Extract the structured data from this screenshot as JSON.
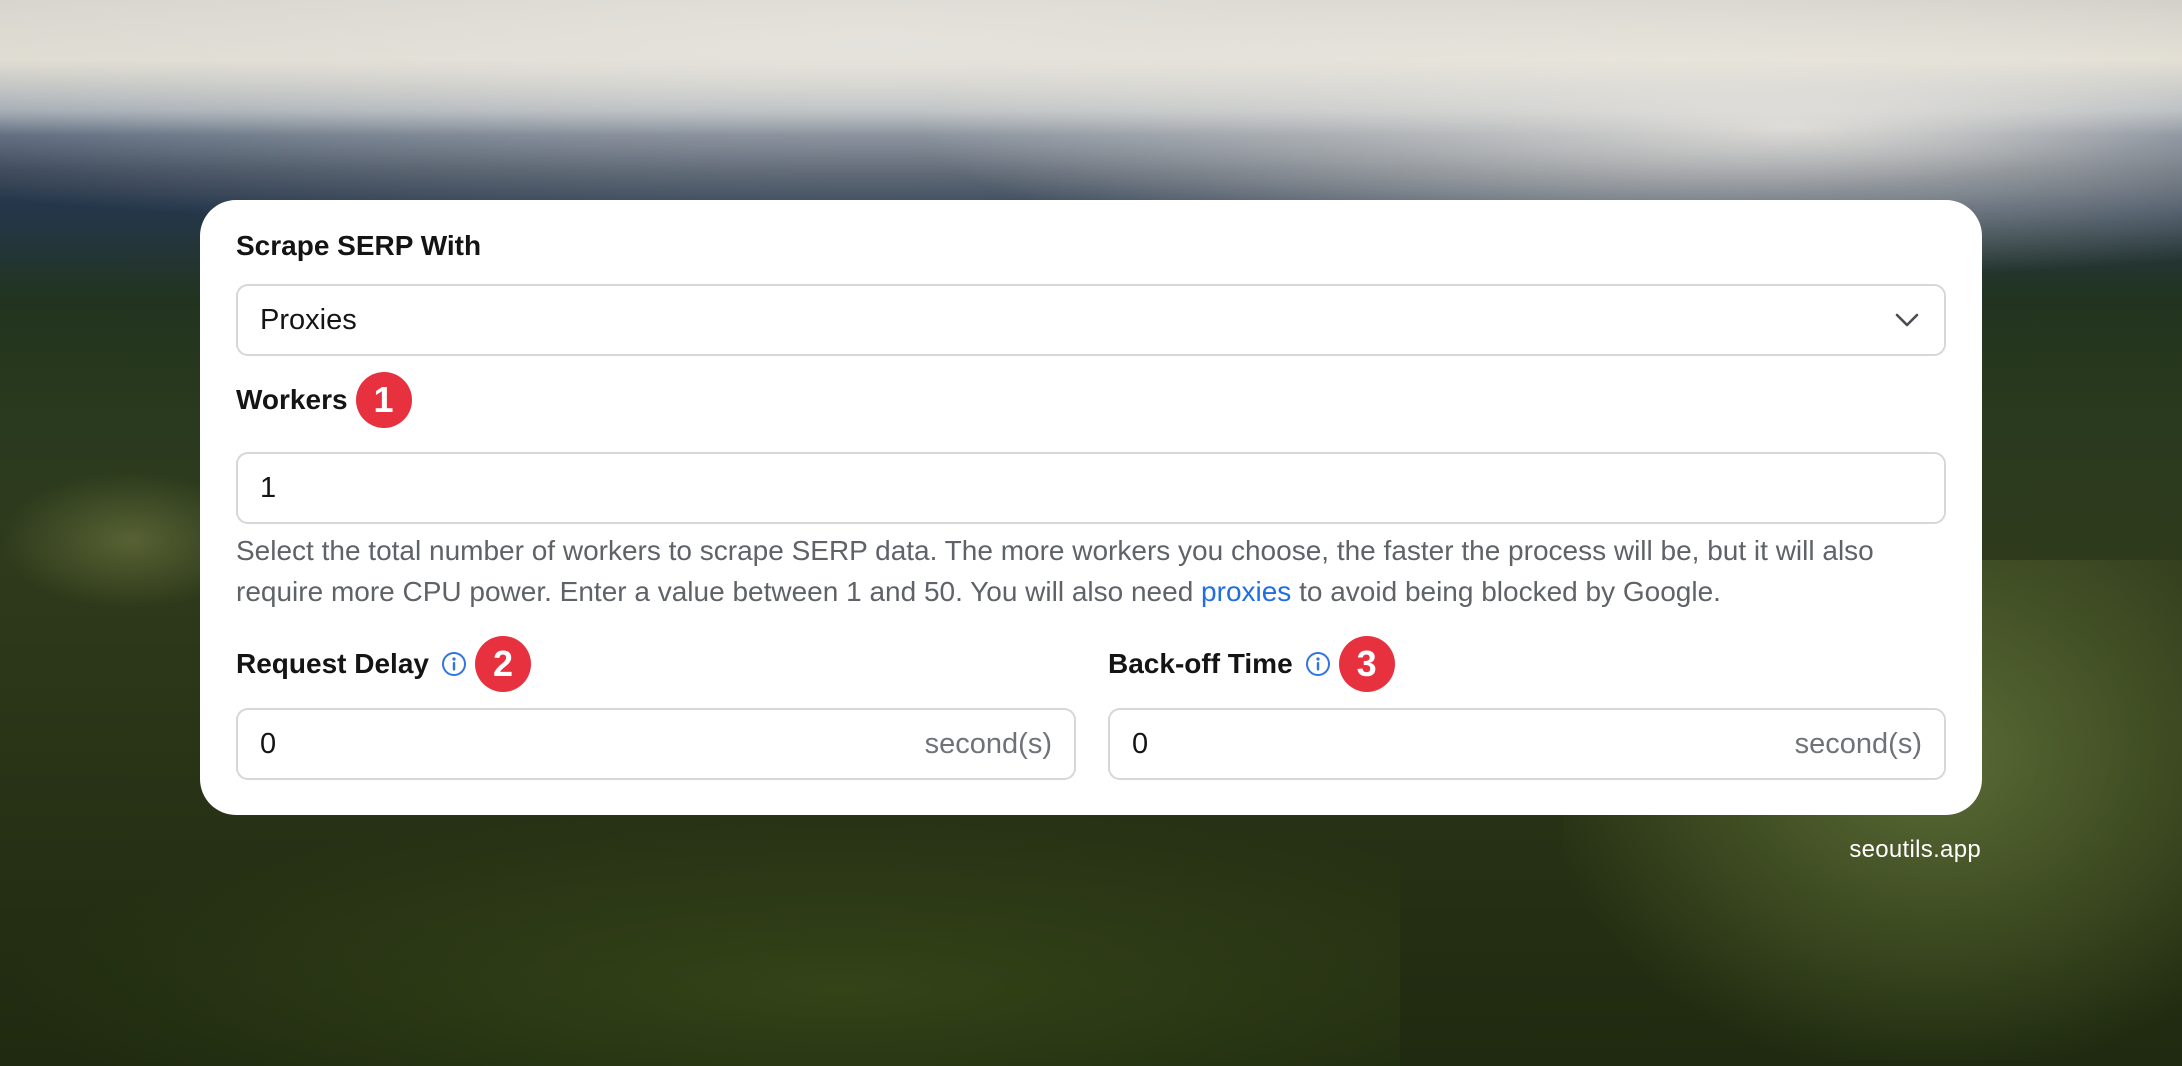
{
  "form": {
    "scrape_label": "Scrape SERP With",
    "scrape_selected": "Proxies",
    "workers_label": "Workers",
    "workers_badge": "1",
    "workers_value": "1",
    "help_text_before": "Select the total number of workers to scrape SERP data. The more workers you choose, the faster the process will be, but it will also require more CPU power. Enter a value between 1 and 50. You will also need ",
    "help_link": "proxies",
    "help_text_after": " to avoid being blocked by Google.",
    "request_delay_label": "Request Delay",
    "request_delay_badge": "2",
    "request_delay_value": "0",
    "request_delay_suffix": "second(s)",
    "backoff_label": "Back-off Time",
    "backoff_badge": "3",
    "backoff_value": "0",
    "backoff_suffix": "second(s)"
  },
  "watermark": "seoutils.app",
  "colors": {
    "accent_link": "#1f6fe0",
    "badge": "#e8313f",
    "info_icon": "#2f74e3"
  }
}
